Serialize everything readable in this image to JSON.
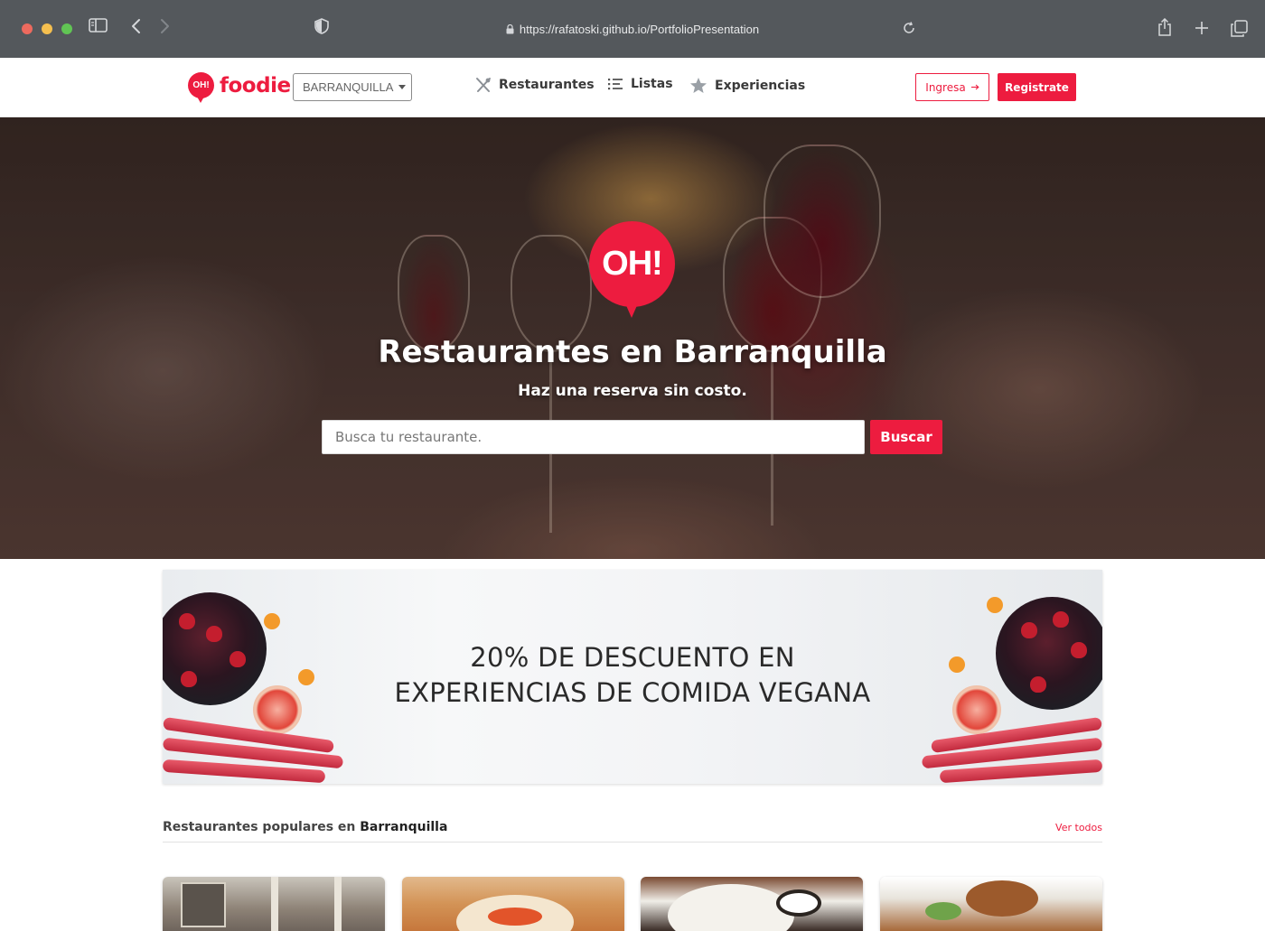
{
  "browser": {
    "url": "https://rafatoski.github.io/PortfolioPresentation",
    "icons": [
      "sidebar-icon",
      "back-icon",
      "forward-icon",
      "shield-icon",
      "lock-icon",
      "reload-icon",
      "share-icon",
      "new-tab-icon",
      "tabs-overview-icon"
    ]
  },
  "header": {
    "logo_badge": "OH!",
    "logo_text": "foodie",
    "city": "BARRANQUILLA",
    "nav": {
      "restaurants": "Restaurantes",
      "lists": "Listas",
      "experiences": "Experiencias"
    },
    "login": "Ingresa",
    "register": "Registrate"
  },
  "hero": {
    "badge": "OH!",
    "title": "Restaurantes en Barranquilla",
    "subtitle": "Haz una reserva sin costo.",
    "search_placeholder": "Busca tu restaurante.",
    "search_button": "Buscar"
  },
  "promo": {
    "line1": "20% DE DESCUENTO EN",
    "line2": "EXPERIENCIAS DE COMIDA VEGANA"
  },
  "popular": {
    "title_prefix": "Restaurantes populares en",
    "title_city": "Barranquilla",
    "see_all": "Ver todos",
    "card_count": 4
  },
  "colors": {
    "brand": "#ed1c3f",
    "chrome": "#54585c"
  }
}
